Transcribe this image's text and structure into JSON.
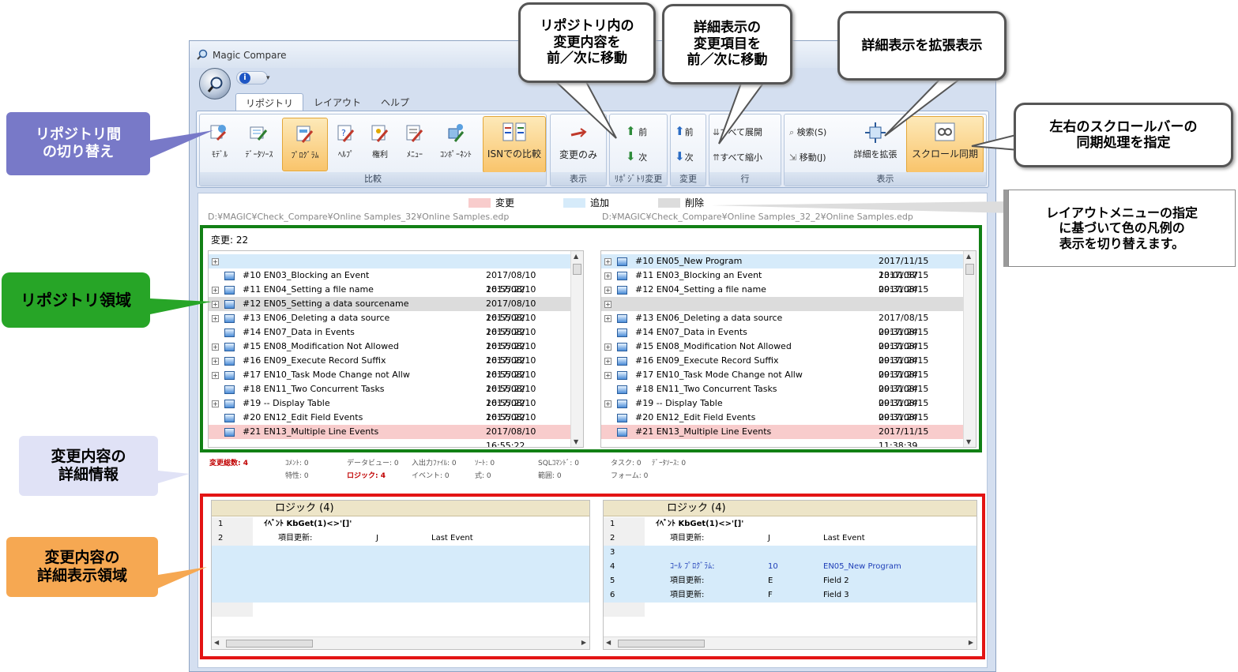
{
  "window": {
    "title": "Magic Compare"
  },
  "tabs": [
    "リポジトリ",
    "レイアウト",
    "ヘルプ"
  ],
  "ribbon": {
    "compare": {
      "label": "比較",
      "buttons": [
        "ﾓﾃﾞﾙ",
        "ﾃﾞｰﾀｿｰｽ",
        "ﾌﾟﾛｸﾞﾗﾑ",
        "ﾍﾙﾌﾟ",
        "権利",
        "ﾒﾆｭｰ",
        "ｺﾝﾎﾟｰﾈﾝﾄ"
      ],
      "isn": "ISNでの比較"
    },
    "display": {
      "label": "表示",
      "button": "変更のみ"
    },
    "repo_change": {
      "label": "ﾘﾎﾟｼﾞﾄﾘ変更",
      "prev": "前",
      "next": "次"
    },
    "change": {
      "label": "変更",
      "prev": "前",
      "next": "次"
    },
    "row": {
      "label": "行",
      "expand": "すべて展開",
      "collapse": "すべて縮小"
    },
    "view": {
      "label": "表示",
      "search": "検索(S)",
      "move": "移動(J)",
      "expand_detail": "詳細を拡張",
      "sync_scroll": "スクロール同期"
    }
  },
  "legend": {
    "change": "変更",
    "add": "追加",
    "delete": "削除"
  },
  "paths": {
    "left": "D:¥MAGIC¥Check_Compare¥Online Samples_32¥Online Samples.edp",
    "right": "D:¥MAGIC¥Check_Compare¥Online Samples_32_2¥Online Samples.edp"
  },
  "repo": {
    "changes": "変更: 22",
    "left_rows": [
      {
        "plus": true,
        "name": "",
        "date": "",
        "state": "add"
      },
      {
        "plus": false,
        "name": "#10  EN03_Blocking an Event",
        "date": "2017/08/10 16:55:22",
        "state": ""
      },
      {
        "plus": true,
        "name": "#11  EN04_Setting a file name",
        "date": "2017/08/10 16:55:22",
        "state": ""
      },
      {
        "plus": true,
        "name": "#12  EN05_Setting a data sourcename",
        "date": "2017/08/10 16:55:22",
        "state": "del"
      },
      {
        "plus": true,
        "name": "#13  EN06_Deleting a data source",
        "date": "2017/08/10 16:55:22",
        "state": ""
      },
      {
        "plus": false,
        "name": "#14  EN07_Data in Events",
        "date": "2017/08/10 16:55:22",
        "state": ""
      },
      {
        "plus": true,
        "name": "#15  EN08_Modification Not Allowed",
        "date": "2017/08/10 16:55:22",
        "state": ""
      },
      {
        "plus": true,
        "name": "#16  EN09_Execute Record Suffix",
        "date": "2017/08/10 16:55:22",
        "state": ""
      },
      {
        "plus": true,
        "name": "#17  EN10_Task Mode Change not Allw",
        "date": "2017/08/10 16:55:22",
        "state": ""
      },
      {
        "plus": false,
        "name": "#18  EN11_Two Concurrent Tasks",
        "date": "2017/08/10 16:55:22",
        "state": ""
      },
      {
        "plus": true,
        "name": "#19  -- Display Table",
        "date": "2017/08/10 16:55:22",
        "state": ""
      },
      {
        "plus": false,
        "name": "#20  EN12_Edit Field Events",
        "date": "2017/08/10 16:55:22",
        "state": ""
      },
      {
        "plus": false,
        "name": "#21  EN13_Multiple Line Events",
        "date": "2017/08/10 16:55:22",
        "state": "chg"
      }
    ],
    "right_rows": [
      {
        "plus": true,
        "name": "#10  EN05_New Program",
        "date": "2017/11/15 13:01:57",
        "state": "add"
      },
      {
        "plus": true,
        "name": "#11  EN03_Blocking an Event",
        "date": "2017/08/15 09:31:24",
        "state": ""
      },
      {
        "plus": true,
        "name": "#12  EN04_Setting a file name",
        "date": "2017/08/15 09:31:24",
        "state": ""
      },
      {
        "plus": true,
        "name": "",
        "date": "",
        "state": "del"
      },
      {
        "plus": true,
        "name": "#13  EN06_Deleting a data source",
        "date": "2017/08/15 09:31:24",
        "state": ""
      },
      {
        "plus": false,
        "name": "#14  EN07_Data in Events",
        "date": "2017/08/15 09:31:24",
        "state": ""
      },
      {
        "plus": true,
        "name": "#15  EN08_Modification Not Allowed",
        "date": "2017/08/15 09:31:24",
        "state": ""
      },
      {
        "plus": true,
        "name": "#16  EN09_Execute Record Suffix",
        "date": "2017/08/15 09:31:24",
        "state": ""
      },
      {
        "plus": true,
        "name": "#17  EN10_Task Mode Change not Allw",
        "date": "2017/08/15 09:31:24",
        "state": ""
      },
      {
        "plus": false,
        "name": "#18  EN11_Two Concurrent Tasks",
        "date": "2017/08/15 09:31:24",
        "state": ""
      },
      {
        "plus": true,
        "name": "#19  -- Display Table",
        "date": "2017/08/15 09:31:24",
        "state": ""
      },
      {
        "plus": false,
        "name": "#20  EN12_Edit Field Events",
        "date": "2017/08/15 09:31:24",
        "state": ""
      },
      {
        "plus": false,
        "name": "#21  EN13_Multiple Line Events",
        "date": "2017/11/15 11:38:39",
        "state": "chg"
      }
    ]
  },
  "stats": {
    "total": "変更総数: 4",
    "comment": "ｺﾒﾝﾄ: 0",
    "dataview": "データビュー: 0",
    "io": "入出力ﾌｧｲﾙ: 0",
    "sort": "ｿｰﾄ: 0",
    "sql": "SQLｺﾏﾝﾄﾞ: 0",
    "task": "タスク: 0",
    "datasource": "ﾃﾞｰﾀｿｰｽ: 0",
    "prop": "特性: 0",
    "logic": "ロジック: 4",
    "event": "イベント: 0",
    "expr": "式: 0",
    "range": "範囲: 0",
    "form": "フォーム: 0"
  },
  "detail": {
    "left_title": "ロジック (4)",
    "right_title": "ロジック (4)",
    "left_rows": [
      {
        "n": "1",
        "a": "ｲﾍﾞﾝﾄ KbGet(1)<>'[]'",
        "b": "",
        "c": "",
        "state": "",
        "bold": true,
        "indent": 1
      },
      {
        "n": "2",
        "a": "項目更新:",
        "b": "J",
        "c": "Last Event",
        "state": "",
        "bold": false,
        "indent": 2
      },
      {
        "n": "",
        "a": "",
        "b": "",
        "c": "",
        "state": "add",
        "bold": false,
        "indent": 0
      },
      {
        "n": "",
        "a": "",
        "b": "",
        "c": "",
        "state": "add",
        "bold": false,
        "indent": 0
      },
      {
        "n": "",
        "a": "",
        "b": "",
        "c": "",
        "state": "add",
        "bold": false,
        "indent": 0
      },
      {
        "n": "",
        "a": "",
        "b": "",
        "c": "",
        "state": "add",
        "bold": false,
        "indent": 0
      },
      {
        "n": "",
        "a": "",
        "b": "",
        "c": "",
        "state": "",
        "bold": false,
        "indent": 0
      }
    ],
    "right_rows": [
      {
        "n": "1",
        "a": "ｲﾍﾞﾝﾄ KbGet(1)<>'[]'",
        "b": "",
        "c": "",
        "state": "",
        "bold": true,
        "indent": 1
      },
      {
        "n": "2",
        "a": "項目更新:",
        "b": "J",
        "c": "Last Event",
        "state": "",
        "bold": false,
        "indent": 2
      },
      {
        "n": "3",
        "a": "",
        "b": "",
        "c": "",
        "state": "add",
        "bold": false,
        "indent": 0
      },
      {
        "n": "4",
        "a": "ｺｰﾙ ﾌﾟﾛｸﾞﾗﾑ:",
        "b": "10",
        "c": "EN05_New Program",
        "state": "add-blue",
        "bold": false,
        "indent": 2
      },
      {
        "n": "5",
        "a": "項目更新:",
        "b": "E",
        "c": "Field 2",
        "state": "add",
        "bold": false,
        "indent": 2
      },
      {
        "n": "6",
        "a": "項目更新:",
        "b": "F",
        "c": "Field 3",
        "state": "add",
        "bold": false,
        "indent": 2
      },
      {
        "n": "",
        "a": "",
        "b": "",
        "c": "",
        "state": "",
        "bold": false,
        "indent": 0
      }
    ]
  },
  "callouts": {
    "repo_switch": "リポジトリ間\nの切り替え",
    "repo_area": "リポジトリ領域",
    "detail_info": "変更内容の\n詳細情報",
    "detail_area": "変更内容の\n詳細表示領域",
    "repo_nav": "リポジトリ内の\n変更内容を\n前／次に移動",
    "detail_nav": "詳細表示の\n変更項目を\n前／次に移動",
    "expand": "詳細表示を拡張表示",
    "sync": "左右のスクロールバーの\n同期処理を指定",
    "legend": "レイアウトメニューの指定\nに基づいて色の凡例の\n表示を切り替えます。"
  },
  "colors": {
    "change": "#f8cccc",
    "add": "#d6ebfa",
    "delete": "#dcdcdc",
    "repo_border": "#128015",
    "detail_border": "#e31414"
  }
}
